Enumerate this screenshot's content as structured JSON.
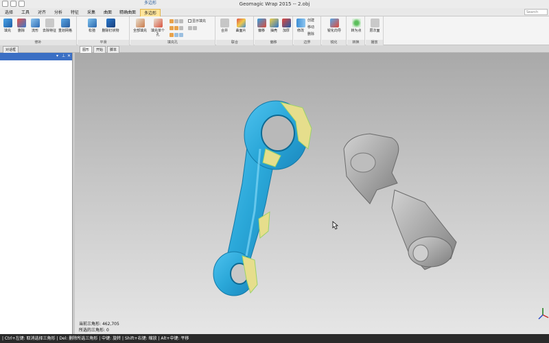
{
  "window": {
    "title": "Geomagic Wrap 2015 -- 2.obj"
  },
  "context_tab_label": "多边形",
  "ribbon_tabs": [
    {
      "label": "选择"
    },
    {
      "label": "工具"
    },
    {
      "label": "对齐"
    },
    {
      "label": "分析"
    },
    {
      "label": "特征"
    },
    {
      "label": "采集"
    },
    {
      "label": "曲面"
    },
    {
      "label": "精确曲面"
    },
    {
      "label": "多边形"
    }
  ],
  "search": {
    "placeholder": "Search"
  },
  "ribbon": {
    "groups": [
      {
        "label": "修补",
        "buttons": [
          "填充",
          "删除",
          "流形",
          "去除特征",
          "重划网格"
        ]
      },
      {
        "label": "平滑",
        "buttons": [
          "松弛",
          "删除钉状物"
        ]
      },
      {
        "label": "填充孔",
        "buttons": [
          "全部填充",
          "填充单个孔"
        ],
        "checkbox": "显示填充"
      },
      {
        "label": "联合",
        "buttons": [
          "合并",
          "曲面片"
        ]
      },
      {
        "label": "偏移",
        "buttons": [
          "偏移",
          "抽壳",
          "加厚"
        ]
      },
      {
        "label": "边界",
        "buttons": [
          "修改",
          "创建",
          "移动",
          "删除"
        ]
      },
      {
        "label": "锐化",
        "buttons": [
          "锐化向导"
        ]
      },
      {
        "label": "转换",
        "buttons": [
          "转为点"
        ]
      },
      {
        "label": "播放",
        "buttons": [
          "层次面"
        ]
      }
    ]
  },
  "left_panel_tab": "对话框",
  "doc_tabs": [
    "图形",
    "开始",
    "脚本"
  ],
  "viewport": {
    "stats": [
      {
        "label": "当前三角形:",
        "value": "462,705"
      },
      {
        "label": "所选的三角形:",
        "value": "0"
      }
    ]
  },
  "status_bar": {
    "text": "| Ctrl+左键: 取消选择三角形 | Del: 删除所选三角形 | 中键: 旋转 | Shift+右键: 缩放 | Alt+中键: 平移"
  },
  "colors": {
    "accent_tab": "#ffe59a",
    "mesh_blue": "#2aa7d8",
    "mesh_yellow": "#e6de8c",
    "mesh_gray": "#a9a9a9",
    "panel_header": "#3b6fc4"
  }
}
